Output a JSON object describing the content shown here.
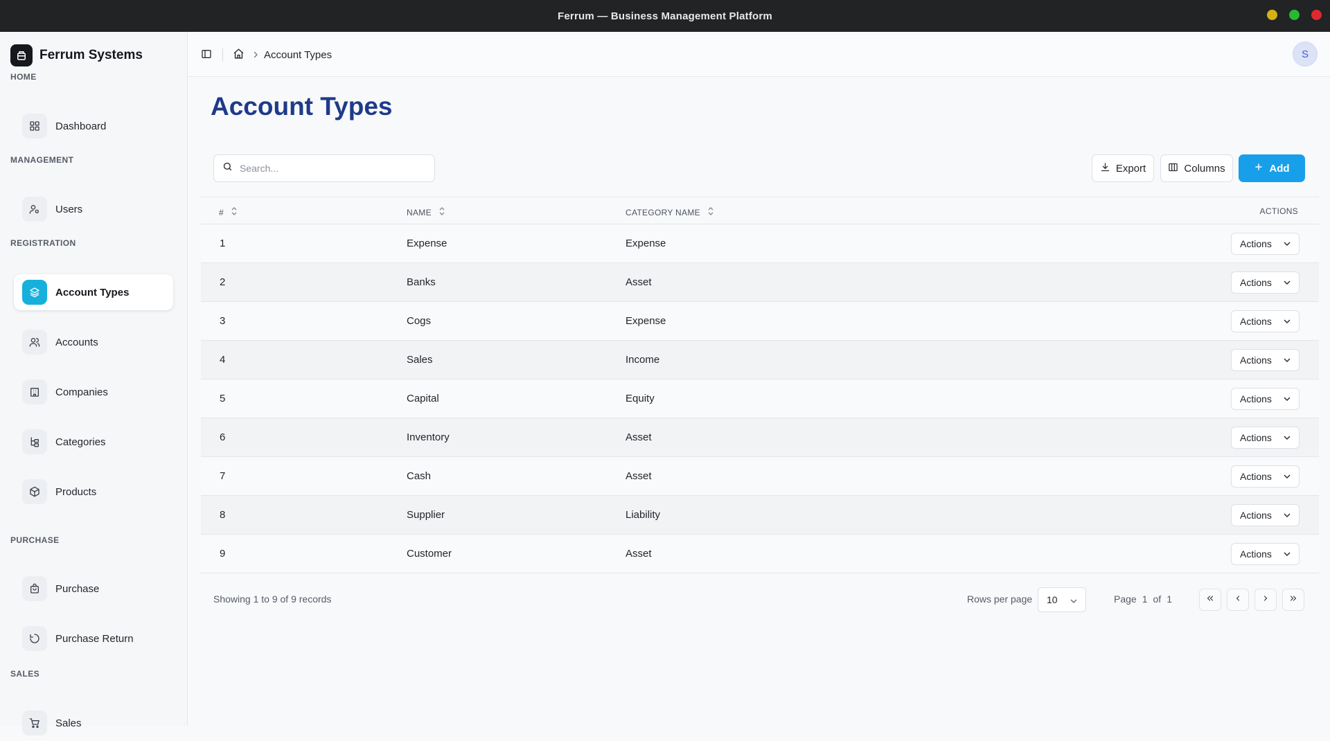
{
  "window": {
    "title": "Ferrum — Business Management Platform",
    "controls": [
      {
        "name": "minimize",
        "color": "#d4b214"
      },
      {
        "name": "maximize",
        "color": "#28b832"
      },
      {
        "name": "close",
        "color": "#e0292e"
      }
    ]
  },
  "brand": {
    "name": "Ferrum Systems"
  },
  "sidebar": {
    "sections": {
      "home": "HOME",
      "management": "MANAGEMENT",
      "registration": "REGISTRATION",
      "purchase": "PURCHASE",
      "sales": "SALES"
    },
    "items": {
      "dashboard": {
        "label": "Dashboard",
        "icon": "grid-icon"
      },
      "users": {
        "label": "Users",
        "icon": "user-icon"
      },
      "account_types": {
        "label": "Account Types",
        "icon": "layers-icon",
        "active": true
      },
      "accounts": {
        "label": "Accounts",
        "icon": "users-icon"
      },
      "companies": {
        "label": "Companies",
        "icon": "building-icon"
      },
      "categories": {
        "label": "Categories",
        "icon": "tree-icon"
      },
      "products": {
        "label": "Products",
        "icon": "package-icon"
      },
      "purchase": {
        "label": "Purchase",
        "icon": "bag-icon"
      },
      "purchase_return": {
        "label": "Purchase Return",
        "icon": "rotate-icon"
      },
      "sales": {
        "label": "Sales",
        "icon": "cart-icon"
      }
    }
  },
  "breadcrumb": {
    "current": "Account Types"
  },
  "user": {
    "initial": "S"
  },
  "page": {
    "title": "Account Types"
  },
  "toolbar": {
    "search_placeholder": "Search...",
    "export_label": "Export",
    "columns_label": "Columns",
    "add_label": "Add"
  },
  "table": {
    "headers": {
      "index": "#",
      "name": "NAME",
      "category": "CATEGORY NAME",
      "actions": "ACTIONS"
    },
    "action_label": "Actions",
    "rows": [
      {
        "id": "1",
        "name": "Expense",
        "category": "Expense"
      },
      {
        "id": "2",
        "name": "Banks",
        "category": "Asset"
      },
      {
        "id": "3",
        "name": "Cogs",
        "category": "Expense"
      },
      {
        "id": "4",
        "name": "Sales",
        "category": "Income"
      },
      {
        "id": "5",
        "name": "Capital",
        "category": "Equity"
      },
      {
        "id": "6",
        "name": "Inventory",
        "category": "Asset"
      },
      {
        "id": "7",
        "name": "Cash",
        "category": "Asset"
      },
      {
        "id": "8",
        "name": "Supplier",
        "category": "Liability"
      },
      {
        "id": "9",
        "name": "Customer",
        "category": "Asset"
      }
    ]
  },
  "pagination": {
    "summary": "Showing 1 to 9 of 9 records",
    "rows_per_page_label": "Rows per page",
    "rows_per_page": "10",
    "page_word": "Page",
    "current_page": "1",
    "of_word": "of",
    "total_pages": "1"
  },
  "colors": {
    "accent": "#179fea",
    "active_icon": "#17b0dd",
    "title": "#1e3a8a"
  }
}
